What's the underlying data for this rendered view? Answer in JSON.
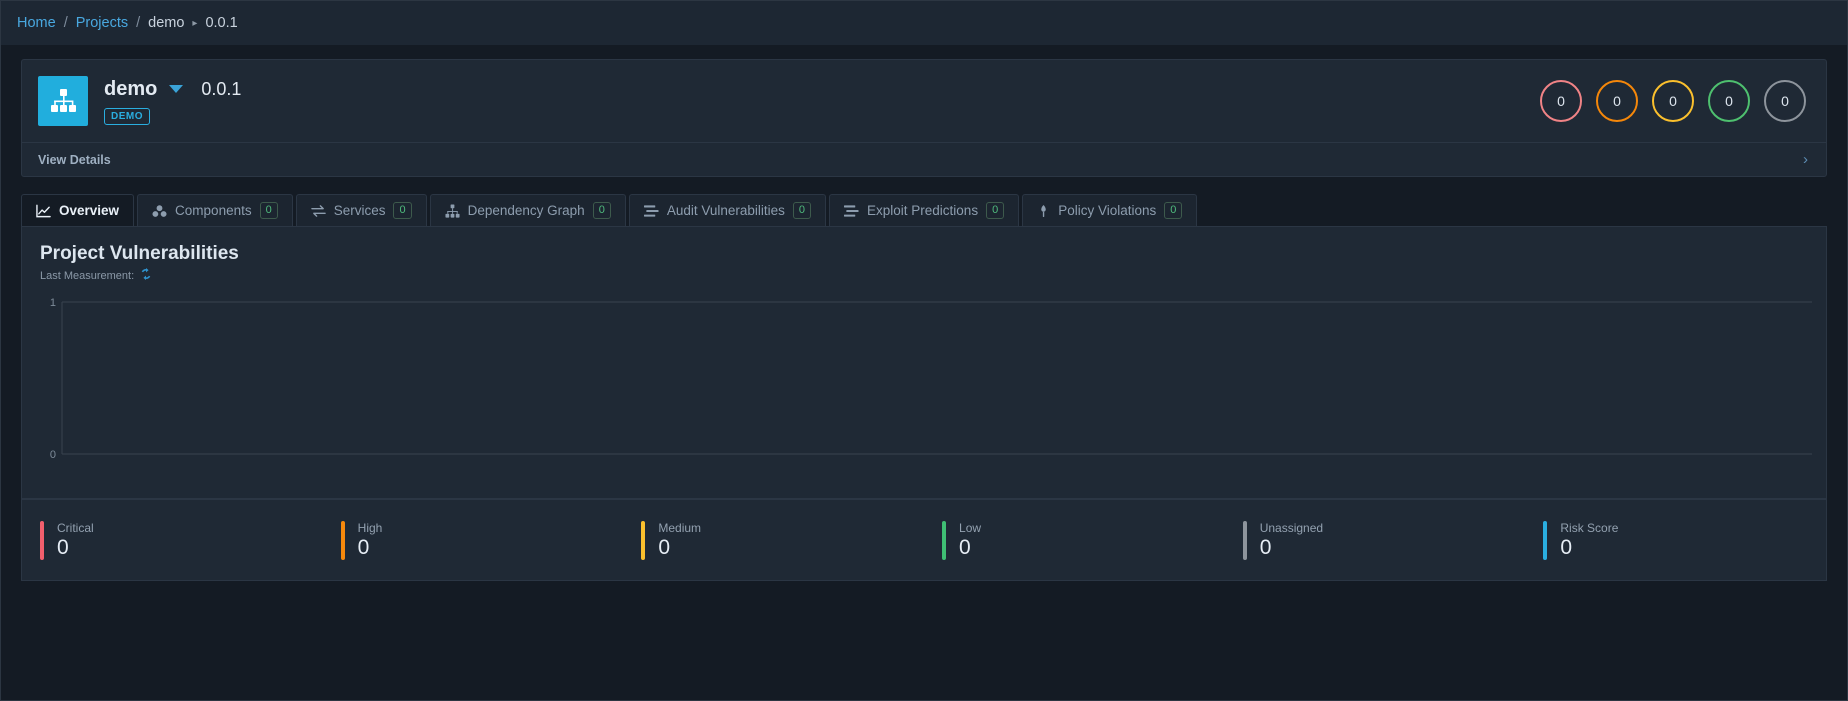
{
  "breadcrumb": {
    "home": "Home",
    "projects": "Projects",
    "separator": "/",
    "project": "demo",
    "arrow": "▸",
    "version": "0.0.1"
  },
  "project": {
    "icon": "sitemap-icon",
    "icon_color": "#21aedd",
    "name": "demo",
    "version": "0.0.1",
    "badge": "DEMO",
    "view_details": "View Details",
    "chevron": "›",
    "severity_circles": [
      {
        "name": "critical",
        "value": "0",
        "color": "#f08386"
      },
      {
        "name": "high",
        "value": "0",
        "color": "#f5870a"
      },
      {
        "name": "medium",
        "value": "0",
        "color": "#fbc02d"
      },
      {
        "name": "low",
        "value": "0",
        "color": "#4ec06f"
      },
      {
        "name": "unassigned",
        "value": "0",
        "color": "#8d949c"
      }
    ]
  },
  "tabs": [
    {
      "label": "Overview",
      "icon": "chart-line-icon",
      "count": null,
      "active": true
    },
    {
      "label": "Components",
      "icon": "cubes-icon",
      "count": "0",
      "active": false
    },
    {
      "label": "Services",
      "icon": "exchange-icon",
      "count": "0",
      "active": false
    },
    {
      "label": "Dependency Graph",
      "icon": "sitemap-icon",
      "count": "0",
      "active": false
    },
    {
      "label": "Audit Vulnerabilities",
      "icon": "list-icon",
      "count": "0",
      "active": false
    },
    {
      "label": "Exploit Predictions",
      "icon": "list-icon",
      "count": "0",
      "active": false
    },
    {
      "label": "Policy Violations",
      "icon": "gavel-icon",
      "count": "0",
      "active": false
    }
  ],
  "panel": {
    "title": "Project Vulnerabilities",
    "subtitle": "Last Measurement:",
    "refresh_icon": "refresh-icon"
  },
  "chart_data": {
    "type": "line",
    "title": "Project Vulnerabilities",
    "xlabel": "",
    "ylabel": "",
    "ylim": [
      0,
      1
    ],
    "yticks": [
      "0",
      "1"
    ],
    "x": [],
    "series": [],
    "grid": true,
    "legend": "none"
  },
  "metrics": [
    {
      "label": "Critical",
      "value": "0",
      "color": "#f25f6d"
    },
    {
      "label": "High",
      "value": "0",
      "color": "#f7890c"
    },
    {
      "label": "Medium",
      "value": "0",
      "color": "#fbc02d"
    },
    {
      "label": "Low",
      "value": "0",
      "color": "#3fbf74"
    },
    {
      "label": "Unassigned",
      "value": "0",
      "color": "#8d949c"
    },
    {
      "label": "Risk Score",
      "value": "0",
      "color": "#2aaee0"
    }
  ]
}
